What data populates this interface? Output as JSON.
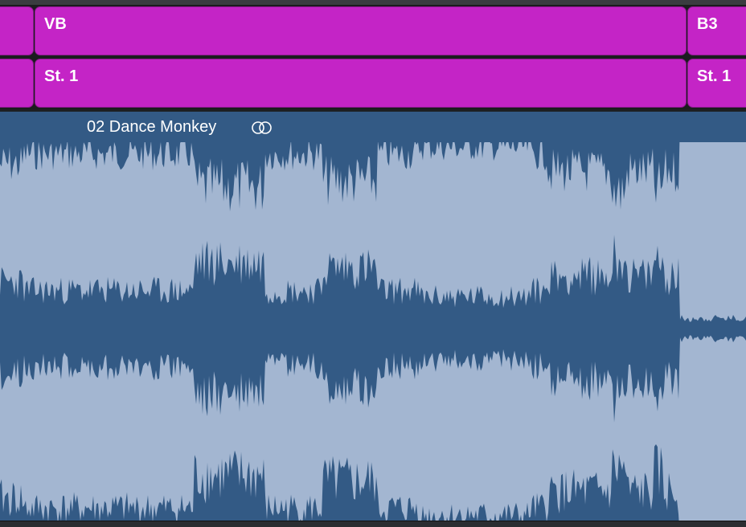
{
  "lanes": [
    {
      "regions": [
        {
          "label": ""
        },
        {
          "label": "VB"
        },
        {
          "label": "B3"
        }
      ]
    },
    {
      "regions": [
        {
          "label": ""
        },
        {
          "label": "St. 1"
        },
        {
          "label": "St. 1"
        }
      ]
    }
  ],
  "audio_region": {
    "title": "02 Dance Monkey",
    "loop_icon": "loop-circles-icon"
  },
  "colors": {
    "region_magenta": "#c424c6",
    "audio_background": "#a3b6d1",
    "waveform_fill": "#335a85"
  }
}
